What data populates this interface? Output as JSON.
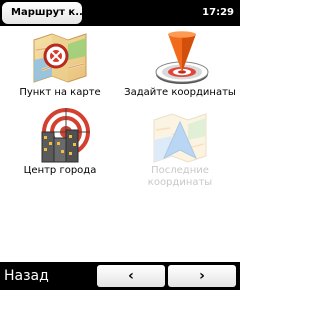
{
  "status_bar": {
    "title": "Маршрут к...",
    "time": "17:29"
  },
  "menu": {
    "items": [
      {
        "label": "Пункт на карте",
        "icon": "map-point-icon",
        "enabled": true
      },
      {
        "label": "Задайте координаты",
        "icon": "coordinates-pin-icon",
        "enabled": true
      },
      {
        "label": "Центр города",
        "icon": "city-center-icon",
        "enabled": true
      },
      {
        "label": "Последние координаты",
        "icon": "recent-coordinates-icon",
        "enabled": false
      }
    ]
  },
  "bottom_bar": {
    "back_label": "Назад",
    "prev_glyph": "‹",
    "next_glyph": "›"
  }
}
